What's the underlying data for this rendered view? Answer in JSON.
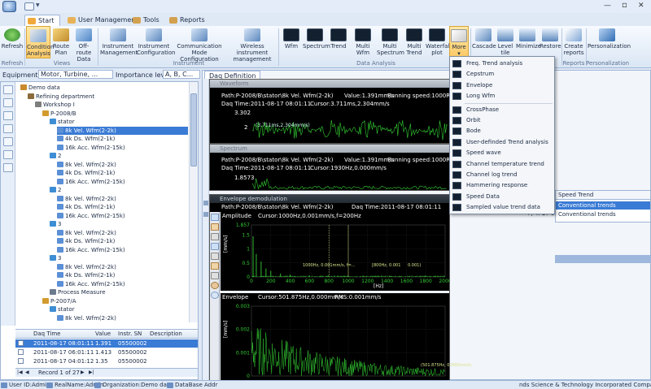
{
  "title_bar": {
    "app_icon": "app-logo",
    "quick_access_icon": "quick-access-menu-icon",
    "quick_access_caret": "▼",
    "title": "",
    "minimize": "—",
    "restore": "▫",
    "close": "✕"
  },
  "ribbon_tabs": [
    {
      "label": "Start",
      "active": true
    },
    {
      "label": "User Management",
      "active": false
    },
    {
      "label": "Tools",
      "active": false
    },
    {
      "label": "Reports",
      "active": false
    }
  ],
  "ribbon": {
    "buttons": [
      {
        "label": "Refresh",
        "line2": ""
      },
      {
        "label": "Condition",
        "line2": "Analysis"
      },
      {
        "label": "Route",
        "line2": "Plan"
      },
      {
        "label": "Off-route",
        "line2": "Data"
      },
      {
        "label": "Instrument",
        "line2": "Management"
      },
      {
        "label": "Instrument",
        "line2": "Configuration"
      },
      {
        "label": "Communication Mode",
        "line2": "Configuration"
      },
      {
        "label": "Wireless instrument",
        "line2": "management"
      },
      {
        "label": "Wfm",
        "line2": ""
      },
      {
        "label": "Spectrum",
        "line2": ""
      },
      {
        "label": "Trend",
        "line2": ""
      },
      {
        "label": "Multi Wfm",
        "line2": ""
      },
      {
        "label": "Multi",
        "line2": "Spectrum"
      },
      {
        "label": "Multi",
        "line2": "Trend"
      },
      {
        "label": "Waterfall",
        "line2": "plot"
      },
      {
        "label": "More",
        "line2": "▾"
      },
      {
        "label": "Cascade",
        "line2": ""
      },
      {
        "label": "Level",
        "line2": "tile"
      },
      {
        "label": "Minimize",
        "line2": ""
      },
      {
        "label": "Restore",
        "line2": ""
      },
      {
        "label": "Create",
        "line2": "reports"
      },
      {
        "label": "Personalization",
        "line2": ""
      }
    ],
    "groups": [
      "Refresh",
      "Views",
      "Instrument",
      "Data Analysis",
      "Reports",
      "Personalization"
    ]
  },
  "filters": {
    "equipment_type_label": "Equipment type:",
    "equipment_type_value": "Motor, Turbine, ...",
    "importance_label": "Importance level:",
    "importance_value": "A, B, C..."
  },
  "tree": [
    {
      "text": "Demo data",
      "level": 0,
      "icon": "database-icon"
    },
    {
      "text": "Refining department",
      "level": 1,
      "icon": "department-icon"
    },
    {
      "text": "Workshop I",
      "level": 2,
      "icon": "workshop-icon"
    },
    {
      "text": "P-2008/B",
      "level": 3,
      "icon": "equipment-icon"
    },
    {
      "text": "stator",
      "level": 4,
      "icon": "measure-point-icon"
    },
    {
      "text": "8k Vel. Wfm(2-2k)",
      "level": 5,
      "icon": "waveform-icon",
      "selected": true
    },
    {
      "text": "4k Ds. Wfm(2-1k)",
      "level": 5,
      "icon": "waveform-icon"
    },
    {
      "text": "16k Acc. Wfm(2-15k)",
      "level": 5,
      "icon": "waveform-icon"
    },
    {
      "text": "2",
      "level": 4,
      "icon": "measure-point-icon"
    },
    {
      "text": "8k Vel. Wfm(2-2k)",
      "level": 5,
      "icon": "waveform-icon"
    },
    {
      "text": "4k Ds. Wfm(2-1k)",
      "level": 5,
      "icon": "waveform-icon"
    },
    {
      "text": "16k Acc. Wfm(2-15k)",
      "level": 5,
      "icon": "waveform-icon"
    },
    {
      "text": "2",
      "level": 4,
      "icon": "measure-point-icon"
    },
    {
      "text": "8k Vel. Wfm(2-2k)",
      "level": 5,
      "icon": "waveform-icon"
    },
    {
      "text": "4k Ds. Wfm(2-1k)",
      "level": 5,
      "icon": "waveform-icon"
    },
    {
      "text": "16k Acc. Wfm(2-15k)",
      "level": 5,
      "icon": "waveform-icon"
    },
    {
      "text": "3",
      "level": 4,
      "icon": "measure-point-icon"
    },
    {
      "text": "8k Vel. Wfm(2-2k)",
      "level": 5,
      "icon": "waveform-icon"
    },
    {
      "text": "4k Ds. Wfm(2-1k)",
      "level": 5,
      "icon": "waveform-icon"
    },
    {
      "text": "16k Acc. Wfm(2-15k)",
      "level": 5,
      "icon": "waveform-icon"
    },
    {
      "text": "3",
      "level": 4,
      "icon": "measure-point-icon"
    },
    {
      "text": "8k Vel. Wfm(2-2k)",
      "level": 5,
      "icon": "waveform-icon"
    },
    {
      "text": "4k Ds. Wfm(2-1k)",
      "level": 5,
      "icon": "waveform-icon"
    },
    {
      "text": "16k Acc. Wfm(2-15k)",
      "level": 5,
      "icon": "waveform-icon"
    },
    {
      "text": "Process Measure",
      "level": 4,
      "icon": "process-icon"
    },
    {
      "text": "P-2007/A",
      "level": 3,
      "icon": "equipment-icon"
    },
    {
      "text": "stator",
      "level": 4,
      "icon": "measure-point-icon"
    },
    {
      "text": "8k Vel. Wfm(2-2k)",
      "level": 5,
      "icon": "waveform-icon"
    }
  ],
  "data_grid": {
    "columns": [
      "Daq Time",
      "Value",
      "Instr. SN",
      "Description"
    ],
    "rows": [
      {
        "time": "2011-08-17 08:01:11",
        "value": "1.391",
        "sn": "05500002",
        "desc": "",
        "selected": true
      },
      {
        "time": "2011-08-17 06:01:11",
        "value": "1.413",
        "sn": "05500002",
        "desc": ""
      },
      {
        "time": "2011-08-17 04:01:12",
        "value": "1.35",
        "sn": "05500002",
        "desc": ""
      }
    ],
    "record_nav": {
      "first": "|◀",
      "prev": "◀",
      "text": "Record 1 of 27",
      "next": "▶",
      "last": "▶|"
    }
  },
  "daq_tab": "Daq Definition",
  "waveform_win": {
    "title": "Waveform",
    "line1": "Path:P-2008/B\\stator\\8k Vel. Wfm(2-2k)",
    "value": "Value:1.391mm/s",
    "speed": "Running speed:1000RPM",
    "line2": "Daq Time:2011-08-17 08:01:11",
    "cursor": "Cursor:3.711ms,2.304mm/s",
    "y_top": "3.302",
    "y_tick": "2",
    "cursor_label": "(3.711ms,2.304mm/s)"
  },
  "spectrum_win": {
    "title": "Spectrum",
    "line1": "Path:P-2008/B\\stator\\8k Vel. Wfm(2-2k)",
    "value": "Value:1.391mm/s",
    "speed": "Running speed:1000RPM",
    "line2": "Daq Time:2011-08-17 08:01:11",
    "cursor": "Cursor:1930Hz,0.000mm/s",
    "y_top": "1.8573"
  },
  "envelope_win": {
    "title": "Envelope demodulation",
    "path": "Path:P-2008/B\\stator\\8k Vel. Wfm(2-2k)",
    "daq": "Daq Time:2011-08-17 08:01:11"
  },
  "amplitude_plot": {
    "header_label": "Amplitude",
    "header_cursor": "Cursor:1000Hz,0.001mm/s,f=200Hz",
    "ylabel": "[mm/s]",
    "xlabel": "[Hz]",
    "cursor_text_1": "1000Hz, 0.001mm/s, f=...",
    "cursor_text_2": "[800Hz, 0.001",
    "cursor_text_3": "0.001)"
  },
  "envelope_plot": {
    "header_label": "Envelope",
    "header_cursor": "Cursor:501.875Hz,0.000mm/s",
    "header_rms": "RMS:0.001mm/s",
    "ylabel": "[mm/s]",
    "cursor_text": "(501.875Hz, 0.000mm/s)"
  },
  "chart_data": [
    {
      "type": "bar",
      "title": "Amplitude",
      "xlabel": "[Hz]",
      "ylabel": "[mm/s]",
      "xlim": [
        0,
        2000
      ],
      "ylim": [
        0,
        1.857
      ],
      "x_ticks": [
        0,
        200,
        400,
        600,
        800,
        1000,
        1200,
        1400,
        1600,
        1800,
        2000
      ],
      "y_ticks": [
        0,
        0.5,
        1,
        1.5,
        1.857
      ],
      "peaks": [
        {
          "x": 17,
          "y": 1.45
        },
        {
          "x": 50,
          "y": 0.82
        },
        {
          "x": 100,
          "y": 0.55
        },
        {
          "x": 150,
          "y": 0.3
        },
        {
          "x": 200,
          "y": 0.22
        },
        {
          "x": 300,
          "y": 0.12
        },
        {
          "x": 400,
          "y": 0.08
        },
        {
          "x": 600,
          "y": 0.05
        }
      ]
    },
    {
      "type": "line",
      "title": "Envelope",
      "ylabel": "[mm/s]",
      "ylim": [
        0,
        0.003
      ],
      "y_ticks": [
        0,
        0.001,
        0.002,
        0.003
      ]
    }
  ],
  "more_menu": [
    "Freq. Trend analysis",
    "Cepstrum",
    "Envelope",
    "Long Wfm",
    "CrossPhase",
    "Orbit",
    "Bode",
    "User-definded Trend analysis",
    "Speed wave",
    "Channel temperature trend",
    "Channel log trend",
    "Hammering response",
    "Speed Data",
    "Sampled value trend data"
  ],
  "right_grid": {
    "header": "Speed Trend",
    "rows": [
      {
        "left": "",
        "text": "Conventional trends",
        "selected": true
      },
      {
        "left": "7, 4: 27 5",
        "text": "Conventional trends"
      }
    ]
  },
  "status_bar": [
    "User ID:Admin",
    "RealName:Admin",
    "Organization:Demo data",
    "DataBase Addr",
    "nds Science & Technology Incorporated Company"
  ],
  "colors": {
    "accent": "#3a7bd5",
    "selected_row": "#3a7bd5",
    "plot_bg": "#000000",
    "trace": "#33cc33",
    "highlight_button": "#fbc966"
  }
}
